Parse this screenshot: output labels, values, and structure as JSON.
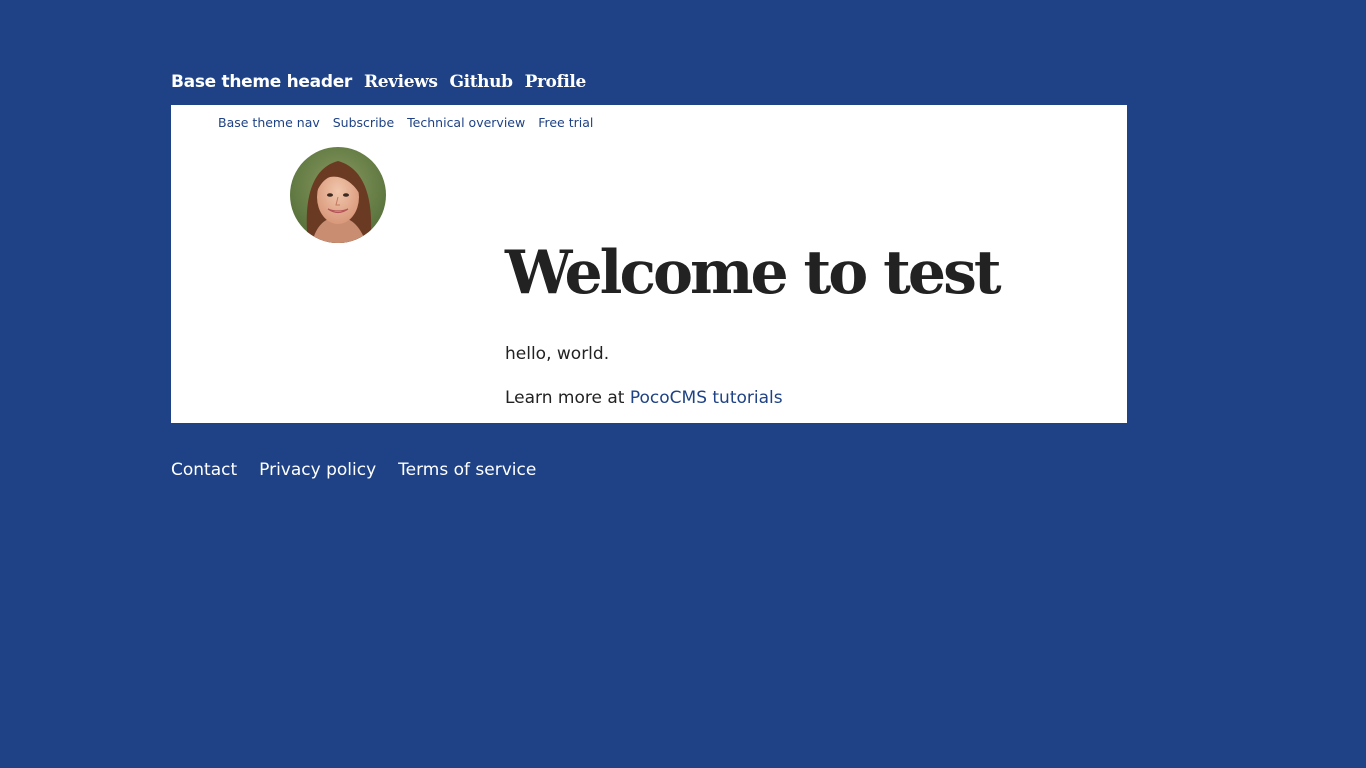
{
  "colors": {
    "page_background": "#1e4285",
    "card_background": "#ffffff",
    "link": "#1e4285",
    "heading": "#222222"
  },
  "header": {
    "title": "Base theme header",
    "links": [
      "Reviews",
      "Github",
      "Profile"
    ]
  },
  "subnav": {
    "items": [
      "Base theme nav",
      "Subscribe",
      "Technical overview",
      "Free trial"
    ]
  },
  "main": {
    "avatar_icon": "profile-photo-woman",
    "heading": "Welcome to test",
    "paragraph": "hello, world.",
    "learn_prefix": "Learn more at",
    "learn_link": "PocoCMS tutorials"
  },
  "footer": {
    "links": [
      "Contact",
      "Privacy policy",
      "Terms of service"
    ]
  }
}
